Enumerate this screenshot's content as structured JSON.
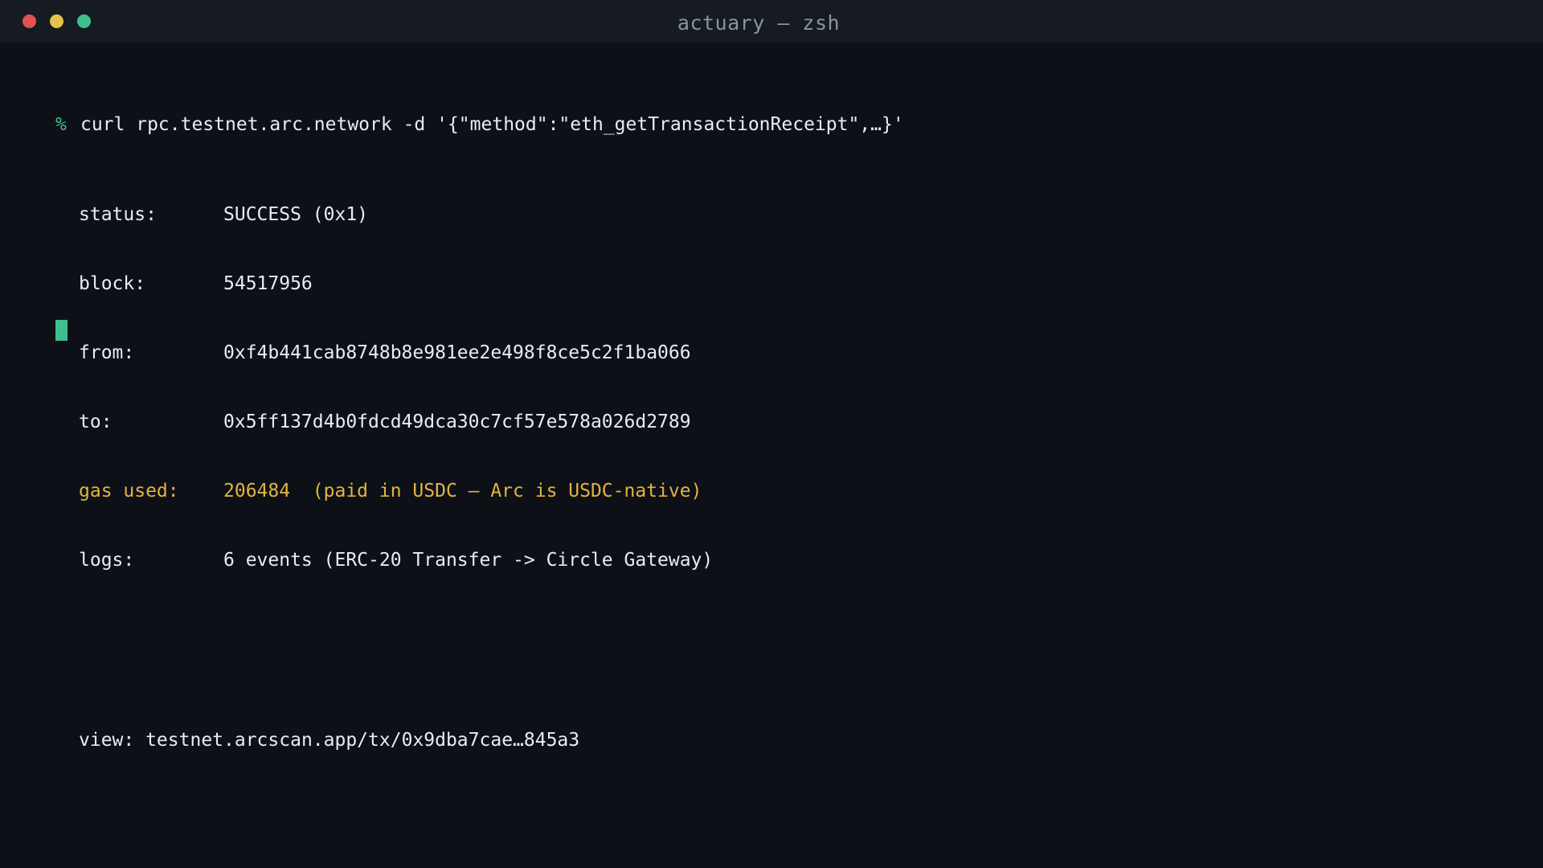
{
  "window": {
    "title": "actuary — zsh",
    "traffic_lights": {
      "close_color": "#e0524e",
      "minimize_color": "#e5c24a",
      "maximize_color": "#3fbf8f"
    }
  },
  "colors": {
    "prompt": "#3fbf8f",
    "text": "#e6edf3",
    "highlight": "#e3b341",
    "cursor": "#3fbf8f"
  },
  "terminal": {
    "prompt_symbol": "%",
    "command": "curl rpc.testnet.arc.network -d '{\"method\":\"eth_getTransactionReceipt\",…}'",
    "output": [
      {
        "key": "status:",
        "value": "SUCCESS (0x1)",
        "highlight": false
      },
      {
        "key": "block:",
        "value": "54517956",
        "highlight": false
      },
      {
        "key": "from:",
        "value": "0xf4b441cab8748b8e981ee2e498f8ce5c2f1ba066",
        "highlight": false
      },
      {
        "key": "to:",
        "value": "0x5ff137d4b0fdcd49dca30c7cf57e578a026d2789",
        "highlight": false
      },
      {
        "key": "gas used:",
        "value": "206484  (paid in USDC — Arc is USDC-native)",
        "highlight": true
      },
      {
        "key": "logs:",
        "value": "6 events (ERC-20 Transfer -> Circle Gateway)",
        "highlight": false
      }
    ],
    "view_line": "view: testnet.arcscan.app/tx/0x9dba7cae…845a3"
  }
}
